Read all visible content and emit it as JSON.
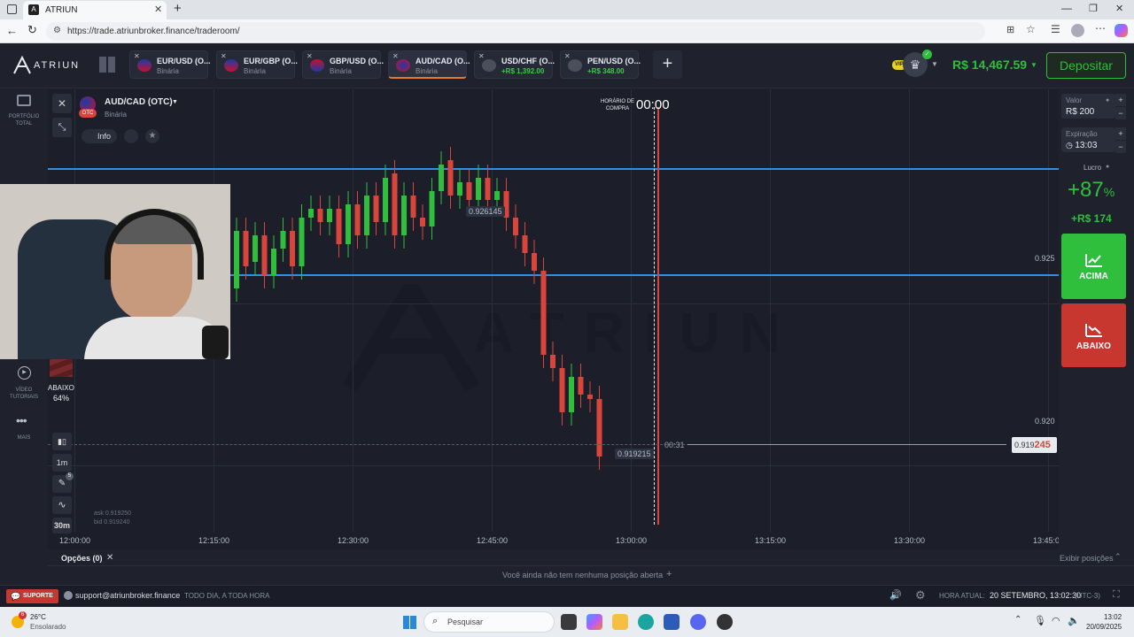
{
  "browser": {
    "tab_title": "ATRIUN",
    "url": "https://trade.atriunbroker.finance/traderoom/"
  },
  "header": {
    "logo": "ATRIUN",
    "balance": "R$ 14,467.59",
    "deposit": "Depositar",
    "vip": "VIP",
    "tabs": [
      {
        "name": "EUR/USD (O...",
        "sub": "Binária",
        "profit": false
      },
      {
        "name": "EUR/GBP (O...",
        "sub": "Binária",
        "profit": false
      },
      {
        "name": "GBP/USD (O...",
        "sub": "Binária",
        "profit": false
      },
      {
        "name": "AUD/CAD (O...",
        "sub": "Binária",
        "profit": false
      },
      {
        "name": "USD/CHF (O...",
        "sub": "+R$ 1,392.00",
        "profit": true
      },
      {
        "name": "PEN/USD (O...",
        "sub": "+R$ 348.00",
        "profit": true
      }
    ]
  },
  "leftnav": {
    "portfolio": "PORTFÓLIO TOTAL",
    "video": "VÍDEO TUTORIAIS",
    "more": "MAIS"
  },
  "asset": {
    "name": "AUD/CAD (OTC)",
    "type": "Binária",
    "info": "Info",
    "otc": "OTC"
  },
  "chart": {
    "purchase_label": "HORÁRIO DE COMPRA",
    "purchase_time": "00:00",
    "high_label": "0.926145",
    "low_label": "0.919215",
    "countdown": "00:31",
    "price_main": "0.919",
    "price_accent": "245",
    "ask": "ask 0.919250",
    "bid": "bid 0.919240",
    "timeframe": "1m",
    "period": "30m",
    "sell_label": "ABAIXO",
    "sell_pct": "64%",
    "watermark": "ATRIUN",
    "pencil_badge": "5",
    "y_ticks": [
      "0.925",
      "0.920"
    ],
    "x_ticks": [
      "12:00:00",
      "12:15:00",
      "12:30:00",
      "12:45:00",
      "13:00:00",
      "13:15:00",
      "13:30:00",
      "13:45:0"
    ]
  },
  "chart_data": {
    "type": "candlestick",
    "ylim": [
      0.9175,
      0.9275
    ],
    "levels": [
      0.9257,
      0.9233
    ],
    "series": [
      {
        "t": 0,
        "o": 0.923,
        "c": 0.9243
      },
      {
        "t": 1,
        "o": 0.9243,
        "c": 0.9235
      },
      {
        "t": 2,
        "o": 0.9236,
        "c": 0.9242
      },
      {
        "t": 3,
        "o": 0.9242,
        "c": 0.9233
      },
      {
        "t": 4,
        "o": 0.9233,
        "c": 0.9239
      },
      {
        "t": 5,
        "o": 0.9239,
        "c": 0.9243
      },
      {
        "t": 6,
        "o": 0.9243,
        "c": 0.9235
      },
      {
        "t": 7,
        "o": 0.9235,
        "c": 0.9246
      },
      {
        "t": 8,
        "o": 0.9246,
        "c": 0.9248
      },
      {
        "t": 9,
        "o": 0.9248,
        "c": 0.9245
      },
      {
        "t": 10,
        "o": 0.9245,
        "c": 0.9248
      },
      {
        "t": 11,
        "o": 0.9248,
        "c": 0.924
      },
      {
        "t": 12,
        "o": 0.924,
        "c": 0.9249
      },
      {
        "t": 13,
        "o": 0.9249,
        "c": 0.9242
      },
      {
        "t": 14,
        "o": 0.9242,
        "c": 0.9251
      },
      {
        "t": 15,
        "o": 0.9251,
        "c": 0.9245
      },
      {
        "t": 16,
        "o": 0.9245,
        "c": 0.9255
      },
      {
        "t": 17,
        "o": 0.9256,
        "c": 0.9242
      },
      {
        "t": 18,
        "o": 0.9242,
        "c": 0.9251
      },
      {
        "t": 19,
        "o": 0.9251,
        "c": 0.9246
      },
      {
        "t": 20,
        "o": 0.9246,
        "c": 0.9244
      },
      {
        "t": 21,
        "o": 0.9244,
        "c": 0.9252
      },
      {
        "t": 22,
        "o": 0.9252,
        "c": 0.9258
      },
      {
        "t": 23,
        "o": 0.9259,
        "c": 0.9251
      },
      {
        "t": 24,
        "o": 0.9251,
        "c": 0.9254
      },
      {
        "t": 25,
        "o": 0.9254,
        "c": 0.925
      },
      {
        "t": 26,
        "o": 0.925,
        "c": 0.9255
      },
      {
        "t": 27,
        "o": 0.9255,
        "c": 0.925
      },
      {
        "t": 28,
        "o": 0.925,
        "c": 0.9252
      },
      {
        "t": 29,
        "o": 0.9252,
        "c": 0.9246
      },
      {
        "t": 30,
        "o": 0.9246,
        "c": 0.9242
      },
      {
        "t": 31,
        "o": 0.9242,
        "c": 0.9238
      },
      {
        "t": 32,
        "o": 0.9238,
        "c": 0.9234
      },
      {
        "t": 33,
        "o": 0.9234,
        "c": 0.9215
      },
      {
        "t": 34,
        "o": 0.9215,
        "c": 0.9212
      },
      {
        "t": 35,
        "o": 0.9212,
        "c": 0.9202
      },
      {
        "t": 36,
        "o": 0.9202,
        "c": 0.921
      },
      {
        "t": 37,
        "o": 0.921,
        "c": 0.9206
      },
      {
        "t": 38,
        "o": 0.9206,
        "c": 0.9205
      },
      {
        "t": 39,
        "o": 0.9205,
        "c": 0.9192
      }
    ]
  },
  "trade": {
    "value_label": "Valor",
    "value": "R$ 200",
    "expiry_label": "Expiração",
    "expiry": "13:03",
    "profit_label": "Lucro",
    "profit_pct": "+87",
    "pct": "%",
    "profit_amount": "+R$ 174",
    "buy": "ACIMA",
    "sell": "ABAIXO"
  },
  "positions": {
    "options": "Opções (0)",
    "show": "Exibir posições",
    "empty": "Você ainda não tem nenhuma posição aberta"
  },
  "footer": {
    "support": "SUPORTE",
    "email": "support@atriunbroker.finance",
    "hours": "TODO DIA, A TODA HORA",
    "time_label": "HORA ATUAL:",
    "time": "20 SETEMBRO, 13:02:30",
    "tz": "(UTC-3)"
  },
  "taskbar": {
    "temp": "26°C",
    "weather": "Ensolarado",
    "search": "Pesquisar",
    "clock": "13:02",
    "date": "20/09/2025",
    "badge": "6"
  },
  "colors": {
    "up": "#2fbf3c",
    "down": "#d9443b",
    "level": "#2f8fe0",
    "accent": "#2fbf3c"
  }
}
